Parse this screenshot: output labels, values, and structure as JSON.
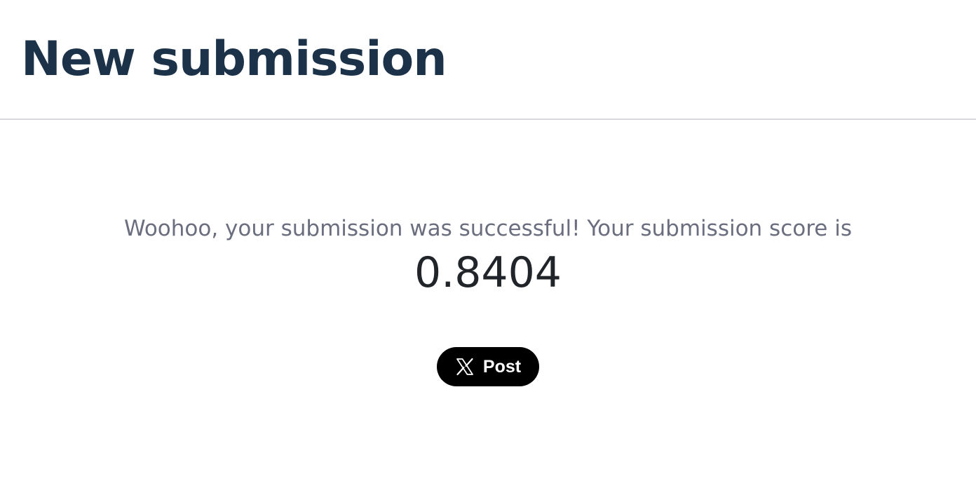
{
  "header": {
    "title": "New submission"
  },
  "result": {
    "message": "Woohoo, your submission was successful! Your submission score is",
    "score": "0.8404"
  },
  "share": {
    "label": "Post",
    "icon": "x-logo-icon"
  },
  "colors": {
    "title": "#1c3249",
    "message": "#6a6e7e",
    "score": "#212529",
    "share_bg": "#000000",
    "share_text": "#ffffff",
    "divider": "#d8d8e2"
  }
}
